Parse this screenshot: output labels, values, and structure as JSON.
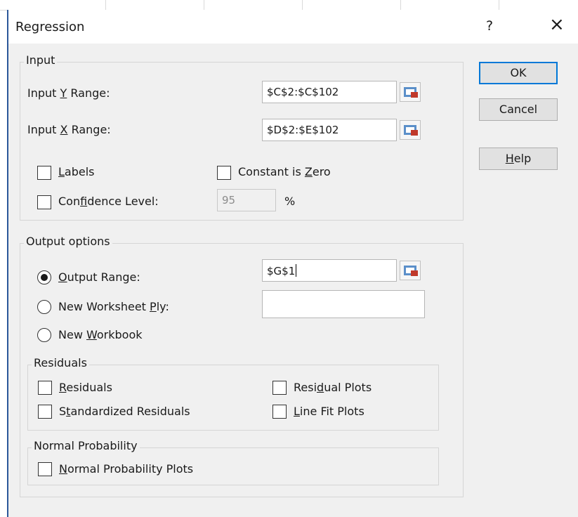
{
  "dialog": {
    "title": "Regression",
    "help_glyph": "?",
    "close_glyph": "×"
  },
  "input": {
    "group_title": "Input",
    "y_range": {
      "label_pre": "Input ",
      "label_key": "Y",
      "label_post": " Range:",
      "value": "$C$2:$C$102"
    },
    "x_range": {
      "label_pre": "Input ",
      "label_key": "X",
      "label_post": " Range:",
      "value": "$D$2:$E$102"
    },
    "labels": {
      "label_key": "L",
      "label_post": "abels",
      "checked": false
    },
    "constant_zero": {
      "label_pre": "Constant is ",
      "label_key": "Z",
      "label_post": "ero",
      "checked": false
    },
    "confidence": {
      "label_pre": "Con",
      "label_key": "f",
      "label_post": "idence Level:",
      "value": "95",
      "unit": "%",
      "checked": false
    }
  },
  "output": {
    "group_title": "Output options",
    "output_range": {
      "label_key": "O",
      "label_post": "utput Range:",
      "value": "$G$1",
      "selected": true
    },
    "new_ply": {
      "label_pre": "New Worksheet ",
      "label_key": "P",
      "label_post": "ly:",
      "value": "",
      "selected": false
    },
    "new_workbook": {
      "label_pre": "New ",
      "label_key": "W",
      "label_post": "orkbook",
      "selected": false
    }
  },
  "residuals": {
    "group_title": "Residuals",
    "residuals": {
      "label_key": "R",
      "label_post": "esiduals"
    },
    "standardized": {
      "label_pre": "S",
      "label_key": "t",
      "label_post": "andardized Residuals"
    },
    "residual_plots": {
      "label_pre": "Resi",
      "label_key": "d",
      "label_post": "ual Plots"
    },
    "line_fit": {
      "label_key": "L",
      "label_post": "ine Fit Plots"
    }
  },
  "normal": {
    "group_title": "Normal Probability",
    "plots": {
      "label_key": "N",
      "label_post": "ormal Probability Plots"
    }
  },
  "buttons": {
    "ok": "OK",
    "cancel": "Cancel",
    "help_key": "H",
    "help_post": "elp"
  },
  "colors": {
    "accent": "#0078d7",
    "dialog_bg": "#f0f0f0",
    "border": "#2b579a"
  },
  "icons": {
    "range_select": "range-select-icon"
  }
}
